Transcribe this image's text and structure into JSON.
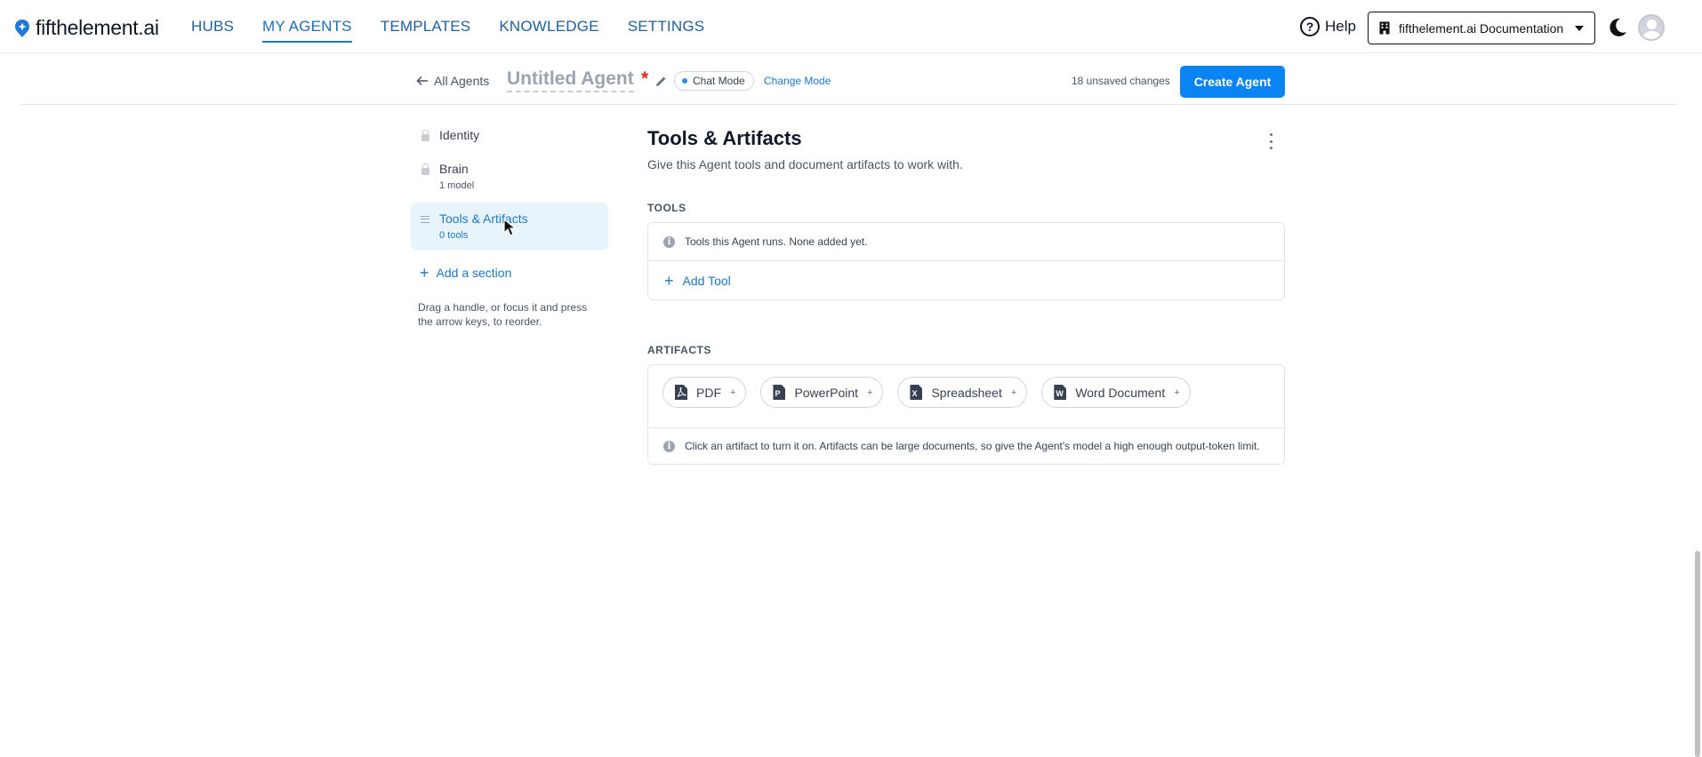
{
  "brand": {
    "name": "fifthelement.ai"
  },
  "nav": [
    {
      "label": "HUBS"
    },
    {
      "label": "MY AGENTS"
    },
    {
      "label": "TEMPLATES"
    },
    {
      "label": "KNOWLEDGE"
    },
    {
      "label": "SETTINGS"
    }
  ],
  "header": {
    "help_label": "Help",
    "org_name": "fifthelement.ai Documentation"
  },
  "subheader": {
    "back_label": "All Agents",
    "agent_title": "Untitled Agent",
    "asterisk": "*",
    "mode_label": "Chat Mode",
    "change_mode_label": "Change Mode",
    "unsaved_label": "18 unsaved changes",
    "create_label": "Create Agent"
  },
  "sections": [
    {
      "label": "Identity",
      "sub": ""
    },
    {
      "label": "Brain",
      "sub": "1 model"
    },
    {
      "label": "Tools & Artifacts",
      "sub": "0 tools"
    }
  ],
  "sidebar": {
    "add_section_label": "Add a section",
    "drag_hint": "Drag a handle, or focus it and press the arrow keys, to reorder."
  },
  "main": {
    "title": "Tools & Artifacts",
    "subtitle": "Give this Agent tools and document artifacts to work with.",
    "tools_heading": "TOOLS",
    "tools_empty": "Tools this Agent runs. None added yet.",
    "add_tool_label": "Add Tool",
    "artifacts_heading": "ARTIFACTS",
    "artifacts": [
      {
        "label": "PDF",
        "glyph": ""
      },
      {
        "label": "PowerPoint",
        "glyph": "P"
      },
      {
        "label": "Spreadsheet",
        "glyph": "X"
      },
      {
        "label": "Word Document",
        "glyph": "W"
      }
    ],
    "artifacts_note": "Click an artifact to turn it on. Artifacts can be large documents, so give the Agent's model a high enough output-token limit."
  },
  "colors": {
    "accent": "#0b84f3",
    "link": "#1d77c7",
    "active_bg": "#e8f4fc"
  }
}
